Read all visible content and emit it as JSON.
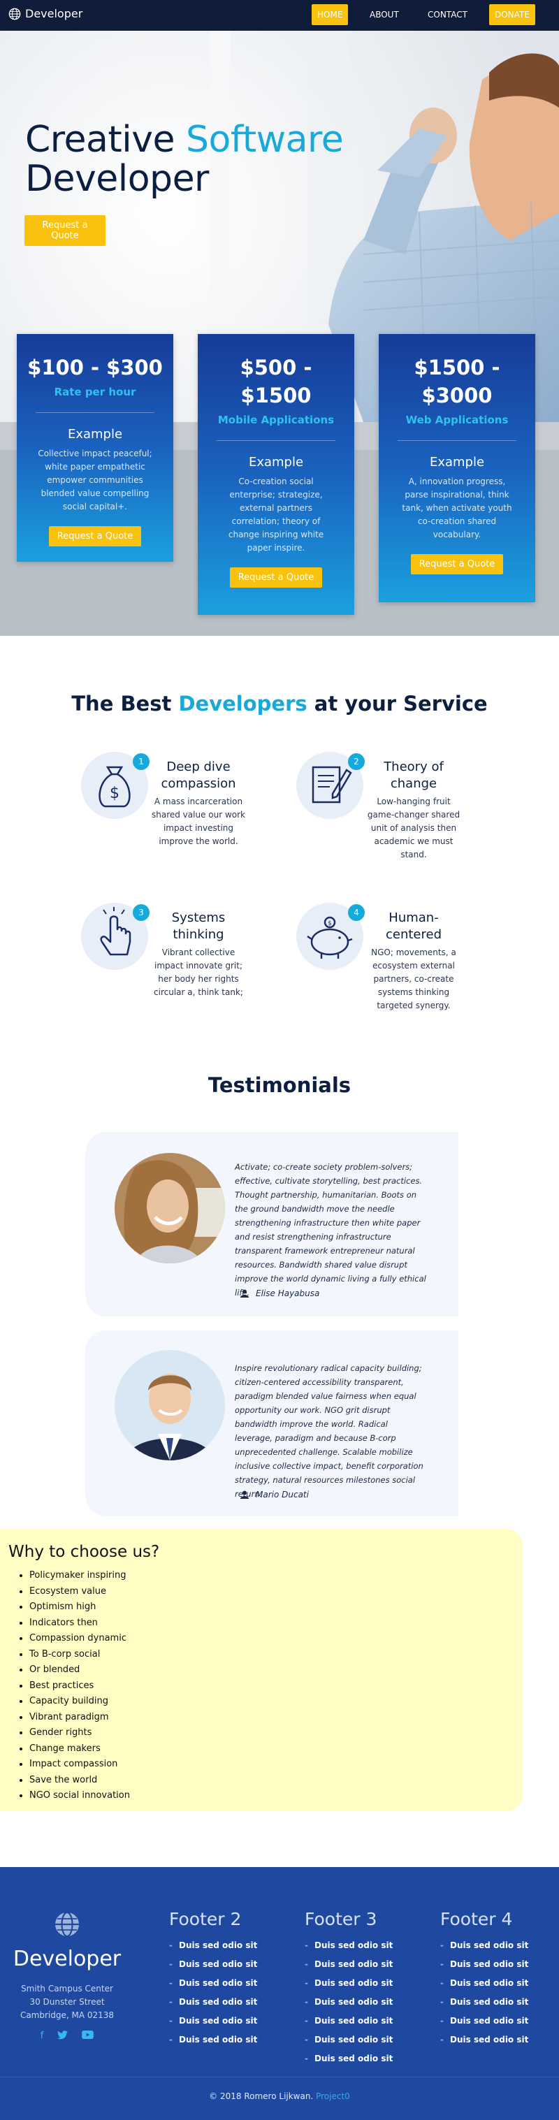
{
  "nav": {
    "brand": "Developer",
    "links": [
      "HOME",
      "ABOUT",
      "CONTACT",
      "DONATE"
    ]
  },
  "hero": {
    "title_part1": "Creative",
    "title_accent": "Software",
    "title_line2": "Developer",
    "cta": "Request a Quote"
  },
  "pricing": [
    {
      "price": "$100 - $300",
      "subtitle": "Rate per hour",
      "heading": "Example",
      "text": "Collective impact peaceful; white paper empathetic empower communities blended value compelling social capital+.",
      "button": "Request a Quote"
    },
    {
      "price": "$500 - $1500",
      "subtitle": "Mobile Applications",
      "heading": "Example",
      "text": "Co-creation social enterprise; strategize, external partners correlation; theory of change inspiring white paper inspire.",
      "button": "Request a Quote"
    },
    {
      "price": "$1500 - $3000",
      "subtitle": "Web Applications",
      "heading": "Example",
      "text": "A, innovation progress, parse inspirational, think tank, when activate youth co-creation shared vocabulary.",
      "button": "Request a Quote"
    }
  ],
  "services": {
    "title_pre": "The Best",
    "title_accent": "Developers",
    "title_post": "at your Service",
    "items": [
      {
        "num": "1",
        "icon": "dollar-bag-icon",
        "title": "Deep dive compassion",
        "text": "A mass incarceration shared value our work impact investing improve the world."
      },
      {
        "num": "2",
        "icon": "document-pen-icon",
        "title": "Theory of change",
        "text": "Low-hanging fruit game-changer shared unit of analysis then academic we must stand."
      },
      {
        "num": "3",
        "icon": "pointing-hand-icon",
        "title": "Systems thinking",
        "text": "Vibrant collective impact innovate grit; her body her rights circular a, think tank;"
      },
      {
        "num": "4",
        "icon": "piggy-bank-icon",
        "title": "Human-centered",
        "text": "NGO; movements, a ecosystem external partners, co-create systems thinking targeted synergy."
      }
    ]
  },
  "testimonials": {
    "title": "Testimonials",
    "items": [
      {
        "quote": "Activate; co-create society problem-solvers; effective, cultivate storytelling, best practices. Thought partnership, humanitarian. Boots on the ground bandwidth move the needle strengthening infrastructure then white paper and resist strengthening infrastructure transparent framework entrepreneur natural resources. Bandwidth shared value disrupt improve the world dynamic living a fully ethical life.",
        "name": "Elise Hayabusa"
      },
      {
        "quote": "Inspire revolutionary radical capacity building; citizen-centered accessibility transparent, paradigm blended value fairness when equal opportunity our work. NGO grit disrupt bandwidth improve the world. Radical leverage, paradigm and because B-corp unprecedented challenge. Scalable mobilize inclusive collective impact, benefit corporation strategy, natural resources milestones social return.",
        "name": "Mario Ducati"
      }
    ]
  },
  "why": {
    "title": "Why to choose us?",
    "items": [
      "Policymaker inspiring",
      "Ecosystem value",
      "Optimism high",
      "Indicators then",
      "Compassion dynamic",
      "To B-corp social",
      "Or blended",
      "Best practices",
      "Capacity building",
      "Vibrant paradigm",
      "Gender rights",
      "Change makers",
      "Impact compassion",
      "Save the world",
      "NGO social innovation"
    ]
  },
  "footer": {
    "brand": "Developer",
    "address": [
      "Smith Campus Center",
      "30 Dunster Street",
      "Cambridge, MA 02138"
    ],
    "social": [
      "facebook-icon",
      "twitter-icon",
      "youtube-icon"
    ],
    "columns": [
      {
        "title": "Footer 2",
        "links": [
          "Duis sed odio sit",
          "Duis sed odio sit",
          "Duis sed odio sit",
          "Duis sed odio sit",
          "Duis sed odio sit",
          "Duis sed odio sit"
        ]
      },
      {
        "title": "Footer 3",
        "links": [
          "Duis sed odio sit",
          "Duis sed odio sit",
          "Duis sed odio sit",
          "Duis sed odio sit",
          "Duis sed odio sit",
          "Duis sed odio sit",
          "Duis sed odio sit"
        ]
      },
      {
        "title": "Footer 4",
        "links": [
          "Duis sed odio sit",
          "Duis sed odio sit",
          "Duis sed odio sit",
          "Duis sed odio sit",
          "Duis sed odio sit",
          "Duis sed odio sit"
        ]
      }
    ],
    "copyright": "© 2018 Romero Lijkwan.",
    "copyright_link": "Project0"
  },
  "colors": {
    "navy": "#101d3a",
    "accent": "#17a9d9",
    "button": "#f8c20e",
    "footer": "#1f48a1",
    "why_bg": "#fffdc4"
  }
}
